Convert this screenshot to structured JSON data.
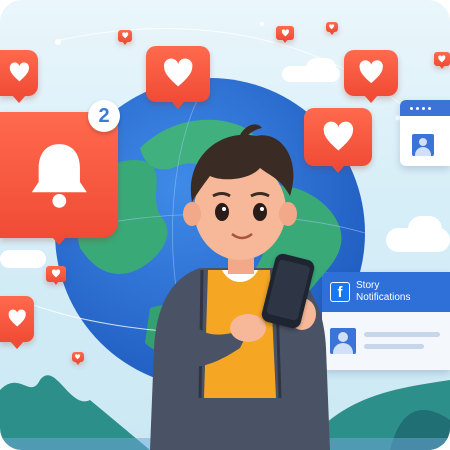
{
  "bell_notification": {
    "count": "2",
    "badge_color": "#ffffff",
    "count_color": "#3a7bd5"
  },
  "story_panel": {
    "brand_icon": "facebook-f-icon",
    "title_line1": "Story",
    "title_line2": "Notifications"
  },
  "colors": {
    "notification_red": "#f04b36",
    "globe_ocean": "#2b6fd4",
    "globe_land": "#3aa978",
    "facebook_blue": "#1877f2",
    "hoodie": "#4a5366",
    "shirt": "#f5a623"
  },
  "icons": [
    "heart-icon",
    "bell-icon",
    "profile-placeholder-icon",
    "smartphone-icon"
  ]
}
